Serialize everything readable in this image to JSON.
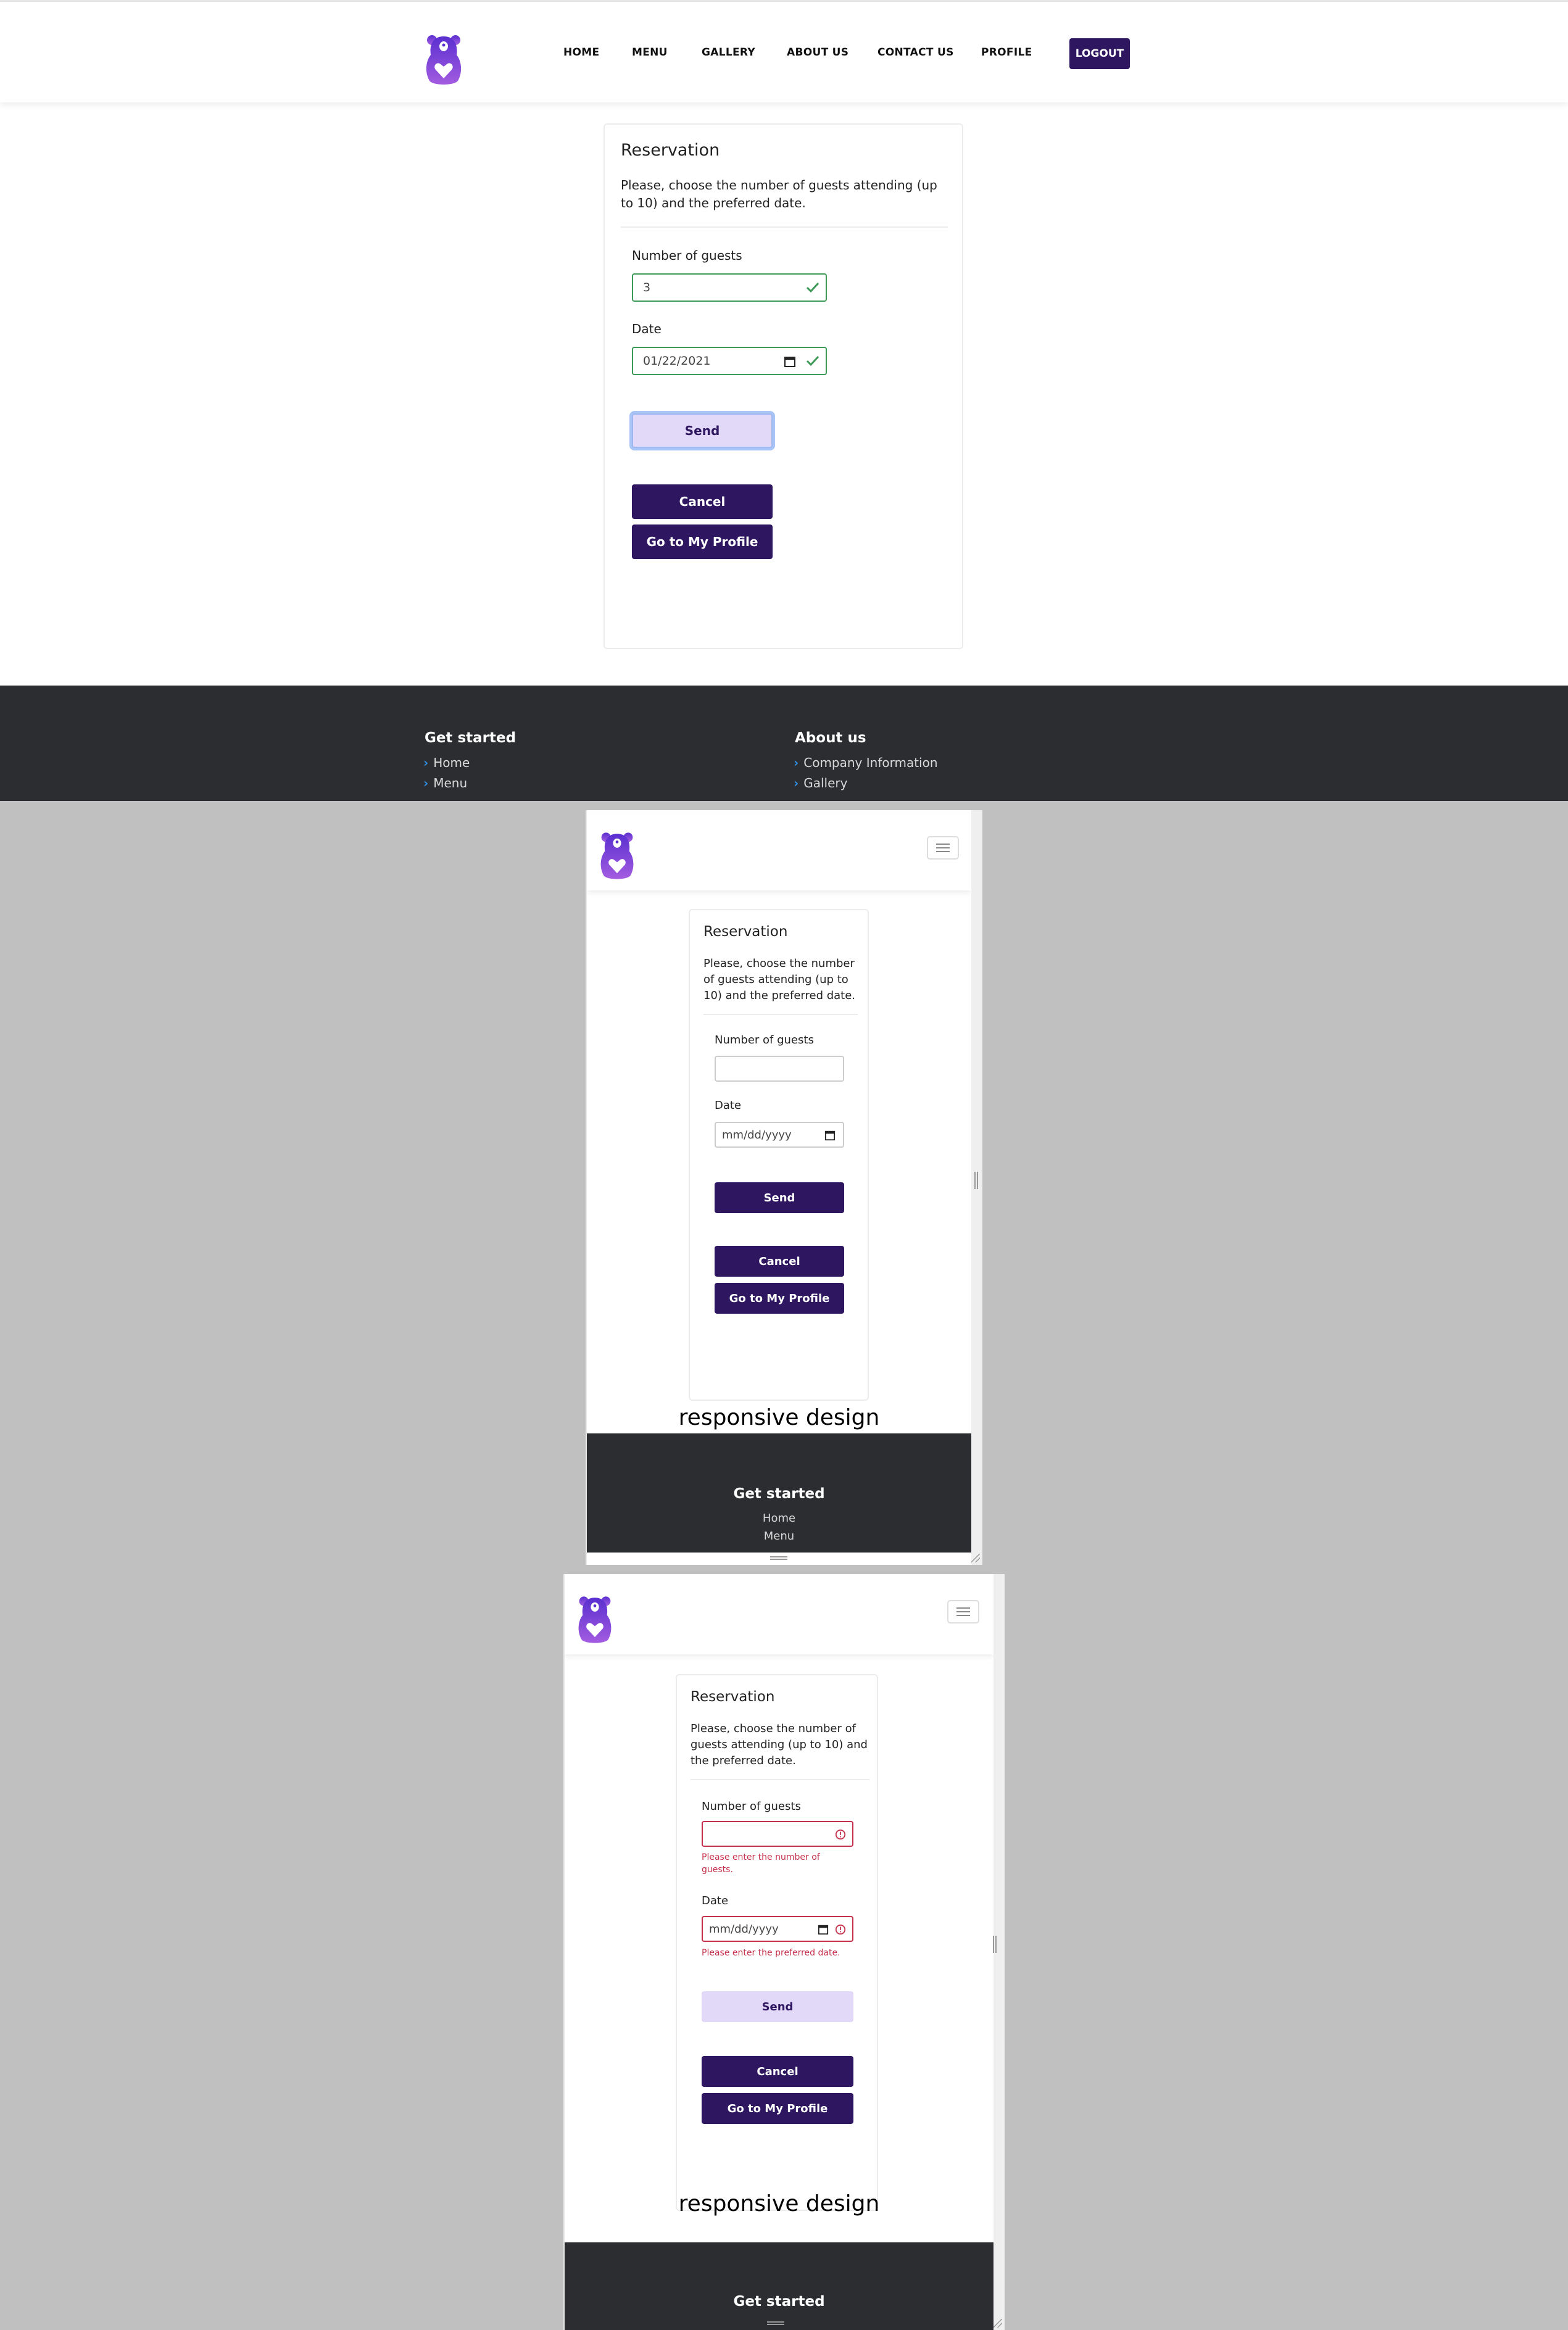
{
  "nav": {
    "links": [
      "HOME",
      "MENU",
      "GALLERY",
      "ABOUT US",
      "CONTACT US",
      "PROFILE"
    ],
    "logout": "LOGOUT"
  },
  "card": {
    "title": "Reservation",
    "desc": "Please, choose the number of guests attending (up to 10) and the preferred date.",
    "guests_label": "Number of guests",
    "date_label": "Date",
    "send": "Send",
    "cancel": "Cancel",
    "profile": "Go to My Profile"
  },
  "desktop_form": {
    "guests_value": "3",
    "date_value": "01/22/2021"
  },
  "date_placeholder": "mm/dd/yyyy",
  "errors": {
    "guests": "Please enter the number of guests.",
    "date": "Please enter the preferred date."
  },
  "footer": {
    "get_started": "Get started",
    "about_us": "About us",
    "home": "Home",
    "menu": "Menu",
    "company": "Company Information",
    "gallery": "Gallery"
  },
  "caption": "responsive design",
  "colors": {
    "brand": "#2e1760",
    "brand_light": "#e2d8f7",
    "valid": "#3d9a56",
    "invalid": "#c4314b",
    "footer_bg": "#2b2d30",
    "link_chevron": "#2f8fe6"
  },
  "icons": [
    "bear-heart-logo",
    "check-icon",
    "calendar-icon",
    "error-icon",
    "hamburger-icon",
    "chevron-right-icon"
  ]
}
